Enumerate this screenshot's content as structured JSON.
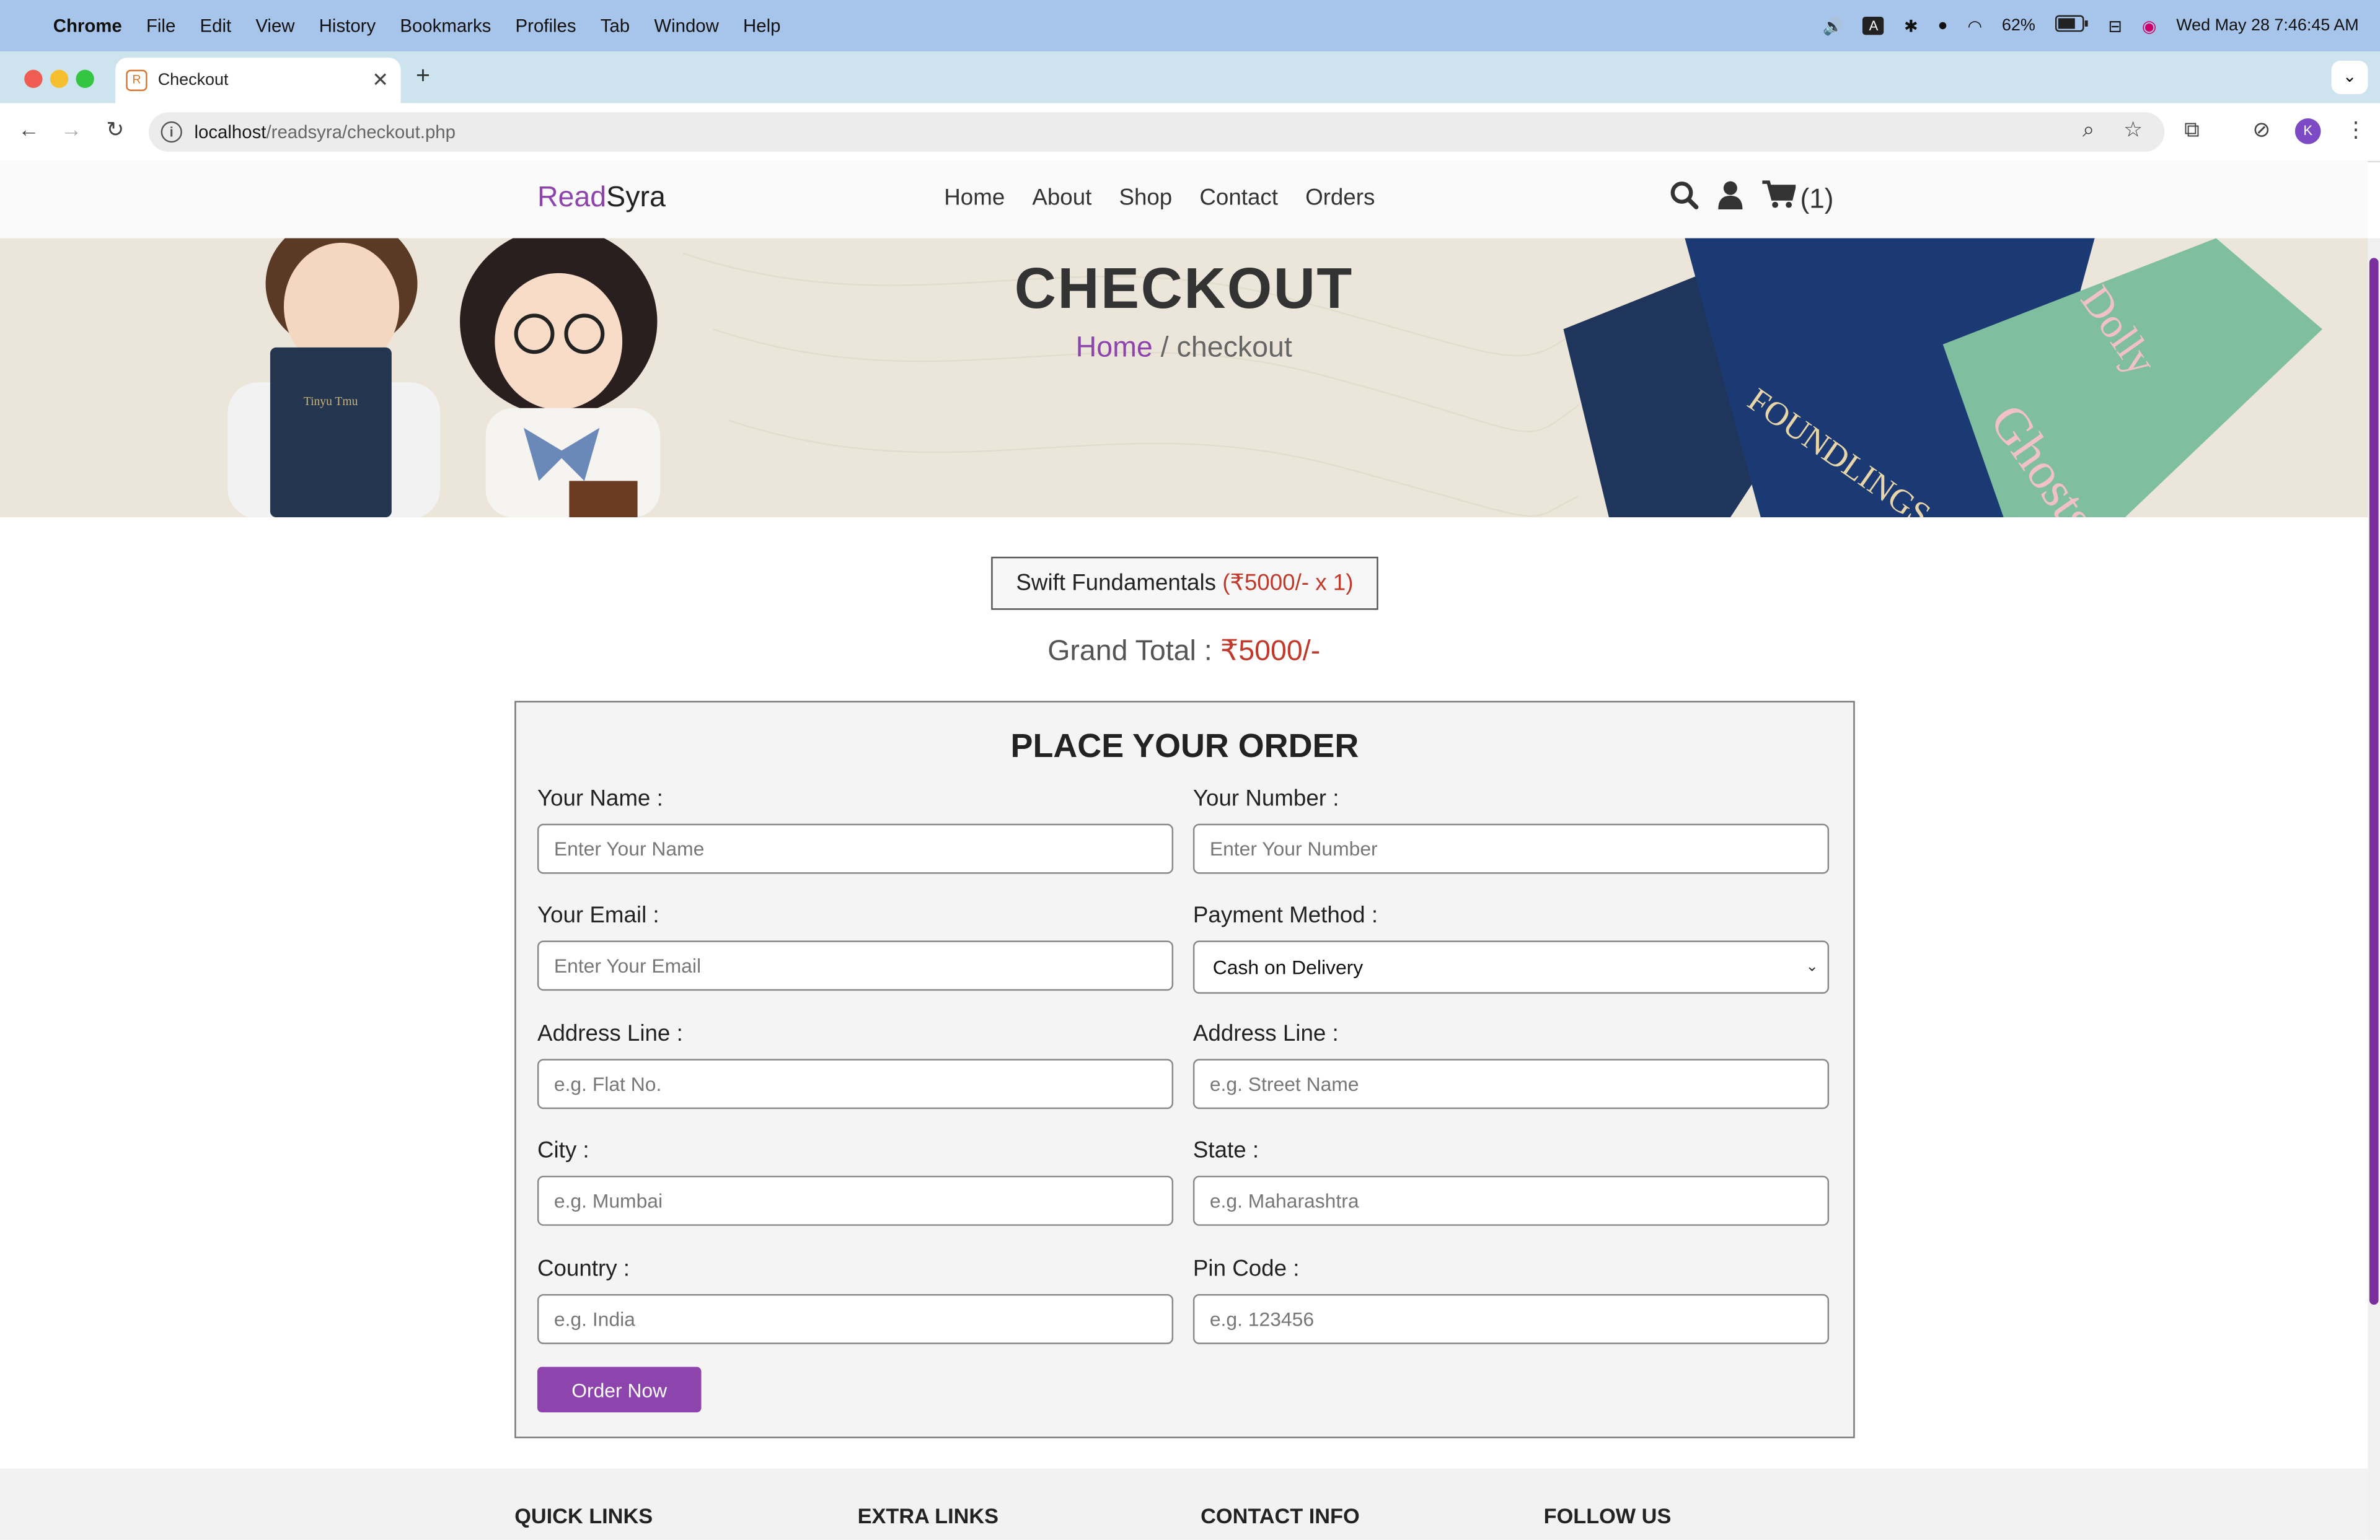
{
  "menubar": {
    "app": "Chrome",
    "items": [
      "File",
      "Edit",
      "View",
      "History",
      "Bookmarks",
      "Profiles",
      "Tab",
      "Window",
      "Help"
    ],
    "battery": "62%",
    "datetime": "Wed May 28  7:46:45 AM"
  },
  "browser": {
    "tab_title": "Checkout",
    "url_host": "localhost",
    "url_path": "/readsyra/checkout.php",
    "profile_initial": "K"
  },
  "site": {
    "logo_a": "Read",
    "logo_b": "Syra",
    "nav": [
      "Home",
      "About",
      "Shop",
      "Contact",
      "Orders"
    ],
    "cart_count": "(1)"
  },
  "hero": {
    "title": "CHECKOUT",
    "crumb_home": "Home",
    "crumb_sep": " / ",
    "crumb_current": "checkout"
  },
  "summary": {
    "item_name": "Swift Fundamentals",
    "item_price": "(₹5000/- x 1)",
    "grand_label": "Grand Total : ",
    "grand_amount": "₹5000/-"
  },
  "form": {
    "title": "PLACE YOUR ORDER",
    "name_label": "Your Name :",
    "name_placeholder": "Enter Your Name",
    "number_label": "Your Number :",
    "number_placeholder": "Enter Your Number",
    "email_label": "Your Email :",
    "email_placeholder": "Enter Your Email",
    "payment_label": "Payment Method :",
    "payment_value": "Cash on Delivery",
    "addr1_label": "Address Line :",
    "addr1_placeholder": "e.g. Flat No.",
    "addr2_label": "Address Line :",
    "addr2_placeholder": "e.g. Street Name",
    "city_label": "City :",
    "city_placeholder": "e.g. Mumbai",
    "state_label": "State :",
    "state_placeholder": "e.g. Maharashtra",
    "country_label": "Country :",
    "country_placeholder": "e.g. India",
    "pin_label": "Pin Code :",
    "pin_placeholder": "e.g. 123456",
    "submit_label": "Order Now"
  },
  "footer": {
    "headings": [
      "QUICK LINKS",
      "EXTRA LINKS",
      "CONTACT INFO",
      "FOLLOW US"
    ]
  },
  "colors": {
    "accent": "#8e44ad",
    "price": "#c0392b"
  }
}
